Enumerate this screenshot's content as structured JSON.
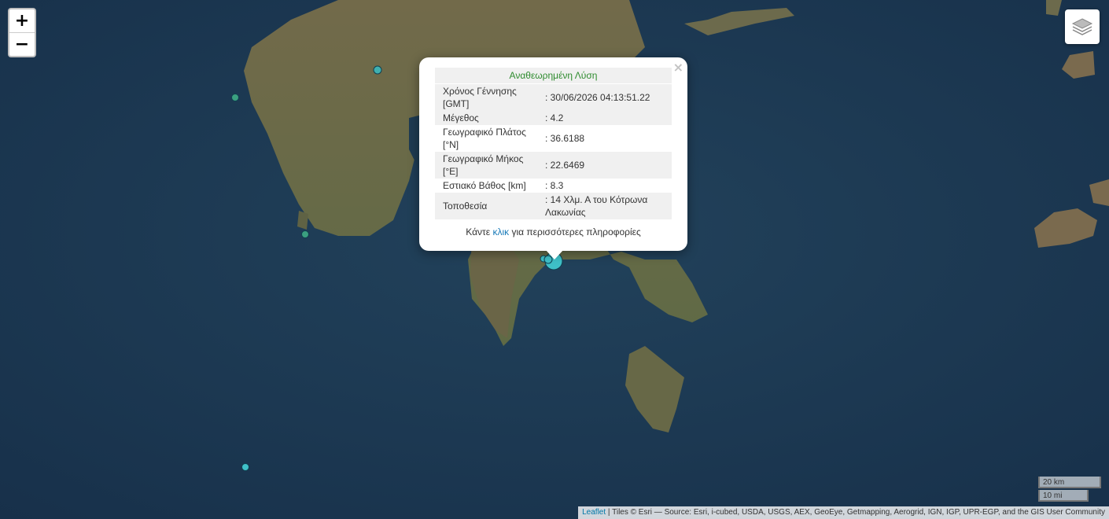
{
  "zoom": {
    "in_label": "+",
    "out_label": "−"
  },
  "popup": {
    "title": "Αναθεωρημένη Λύση",
    "rows": [
      {
        "key": "Χρόνος Γέννησης [GMT]",
        "value": ": 30/06/2026 04:13:51.22"
      },
      {
        "key": "Μέγεθος",
        "value": ": 4.2"
      },
      {
        "key": "Γεωγραφικό Πλάτος [°N]",
        "value": ": 36.6188"
      },
      {
        "key": "Γεωγραφικό Μήκος [°E]",
        "value": ": 22.6469"
      },
      {
        "key": "Εστιακό Βάθος [km]",
        "value": ": 8.3"
      },
      {
        "key": "Τοποθεσία",
        "value": ": 14 Χλμ. Α του Κότρωνα Λακωνίας"
      }
    ],
    "more_prefix": "Κάντε ",
    "more_link": "κλικ",
    "more_suffix": " για περισσότερες πληροφορίες",
    "close_label": "×"
  },
  "scale": {
    "km_label": "20 km",
    "mi_label": "10 mi"
  },
  "attribution": {
    "leaflet": "Leaflet",
    "text": " | Tiles © Esri — Source: Esri, i-cubed, USDA, USGS, AEX, GeoEye, Getmapping, Aerogrid, IGN, IGP, UPR-EGP, and the GIS User Community"
  },
  "colors": {
    "sea": "#1e3b52",
    "land": "#6b6848",
    "marker": "#3fc0c8",
    "marker_alt": "#3ba080"
  }
}
